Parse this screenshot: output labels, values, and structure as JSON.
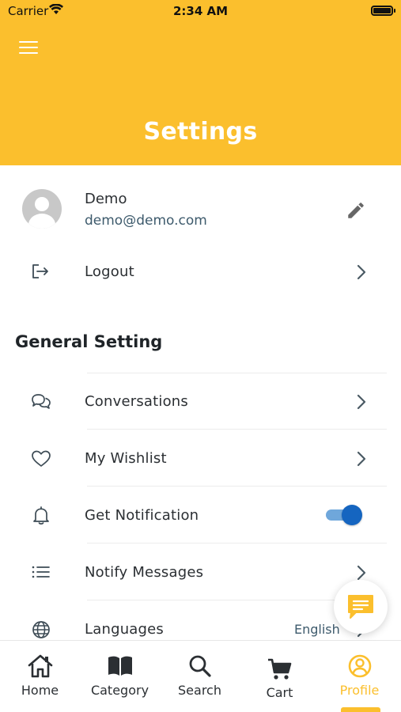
{
  "status_bar": {
    "carrier": "Carrier",
    "time": "2:34 AM"
  },
  "header": {
    "title": "Settings"
  },
  "profile": {
    "name": "Demo",
    "email": "demo@demo.com"
  },
  "account_items": [
    {
      "label": "Logout",
      "icon": "logout-icon"
    }
  ],
  "general_section": {
    "title": "General Setting",
    "items": [
      {
        "label": "Conversations",
        "icon": "chat-bubbles-icon"
      },
      {
        "label": "My Wishlist",
        "icon": "heart-icon"
      },
      {
        "label": "Get Notification",
        "icon": "bell-icon",
        "toggle_on": true
      },
      {
        "label": "Notify Messages",
        "icon": "list-icon"
      },
      {
        "label": "Languages",
        "icon": "globe-icon",
        "value": "English"
      }
    ]
  },
  "tabs": [
    {
      "label": "Home",
      "icon": "home-icon"
    },
    {
      "label": "Category",
      "icon": "book-icon"
    },
    {
      "label": "Search",
      "icon": "search-icon"
    },
    {
      "label": "Cart",
      "icon": "cart-icon"
    },
    {
      "label": "Profile",
      "icon": "profile-icon",
      "active": true
    }
  ],
  "colors": {
    "accent": "#fbbf2d",
    "toggle_on": "#1565c0",
    "secondary_text": "#3d5a6c"
  }
}
